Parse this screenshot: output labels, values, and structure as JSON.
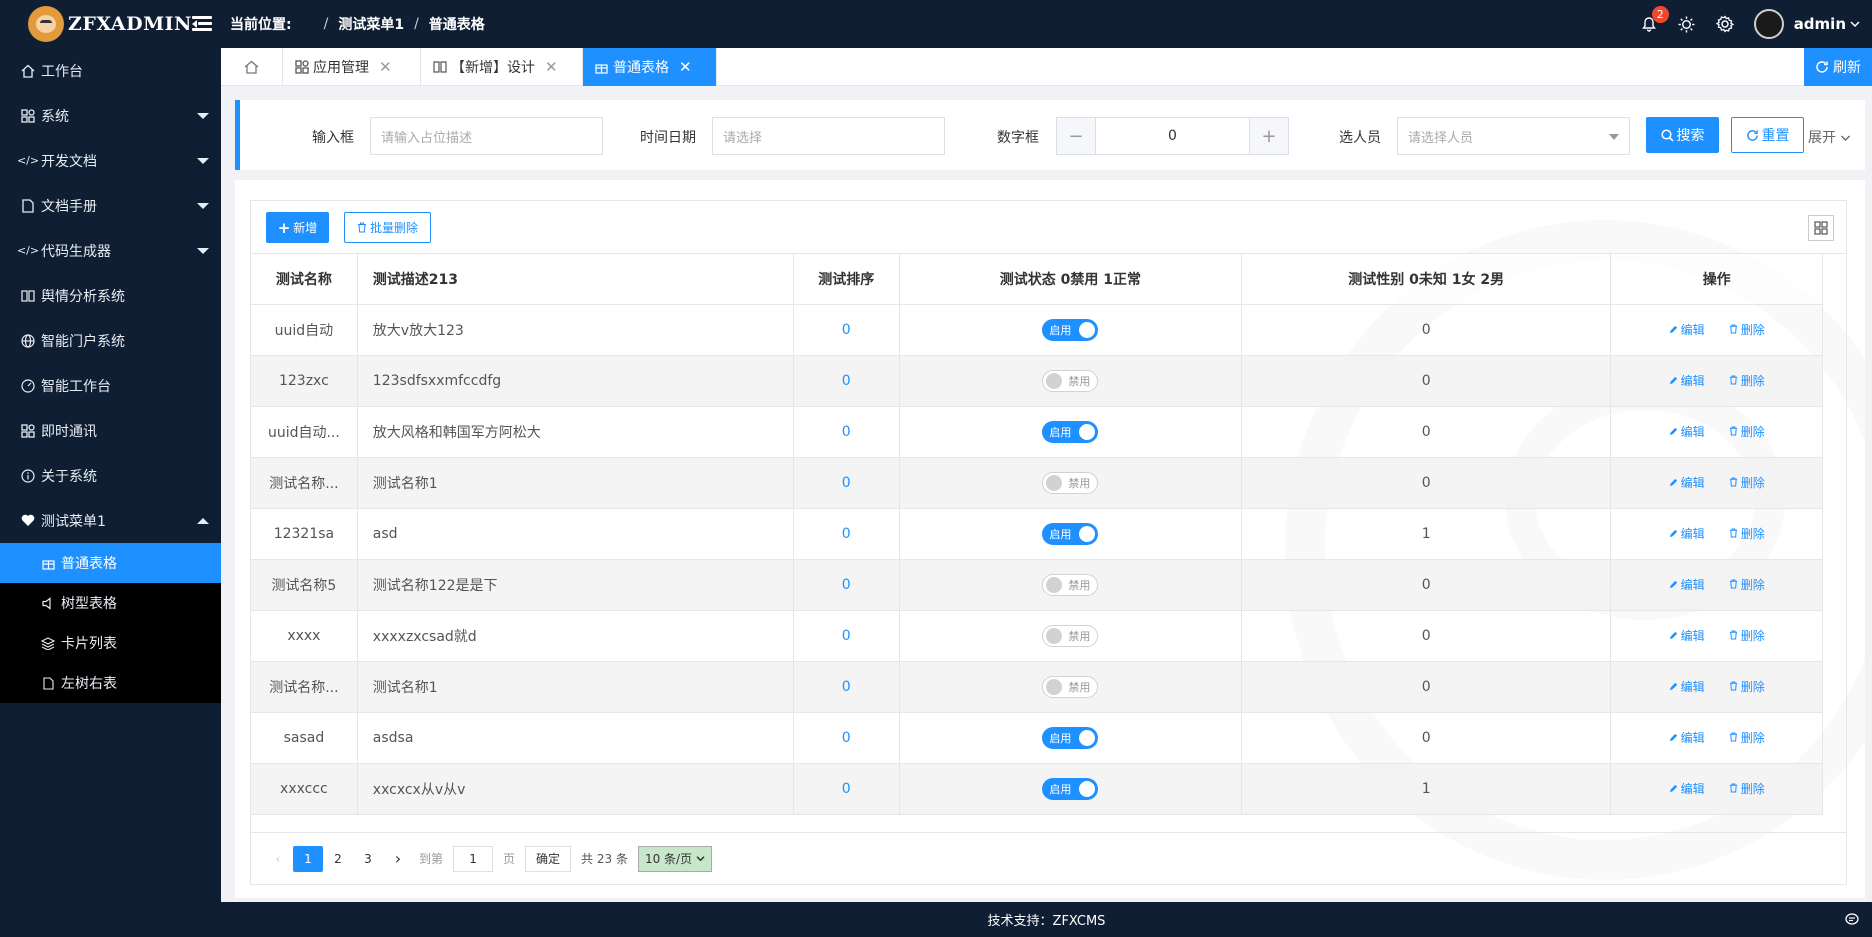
{
  "app": {
    "logo_text": "ZFXADMIN"
  },
  "header": {
    "location_label": "当前位置:",
    "crumbs": [
      "测试菜单1",
      "普通表格"
    ],
    "notification_count": "2",
    "user_name": "admin"
  },
  "sidebar": {
    "items": [
      {
        "label": "工作台",
        "icon": "home-icon"
      },
      {
        "label": "系统",
        "icon": "grid-icon"
      },
      {
        "label": "开发文档",
        "icon": "code-icon"
      },
      {
        "label": "文档手册",
        "icon": "file-icon"
      },
      {
        "label": "代码生成器",
        "icon": "code-icon"
      },
      {
        "label": "舆情分析系统",
        "icon": "read-icon"
      },
      {
        "label": "智能门户系统",
        "icon": "globe-icon"
      },
      {
        "label": "智能工作台",
        "icon": "dashboard-icon"
      },
      {
        "label": "即时通讯",
        "icon": "grid-icon"
      },
      {
        "label": "关于系统",
        "icon": "info-icon"
      },
      {
        "label": "测试菜单1",
        "icon": "heart-icon"
      }
    ],
    "sub_items": [
      {
        "label": "普通表格",
        "icon": "table-icon"
      },
      {
        "label": "树型表格",
        "icon": "speaker-icon"
      },
      {
        "label": "卡片列表",
        "icon": "layers-icon"
      },
      {
        "label": "左树右表",
        "icon": "doc-icon"
      }
    ]
  },
  "tabs": [
    {
      "label": "应用管理"
    },
    {
      "label": "【新增】设计"
    },
    {
      "label": "普通表格"
    }
  ],
  "refresh_label": "刷新",
  "search": {
    "input_label": "输入框",
    "input_placeholder": "请输入占位描述",
    "date_label": "时间日期",
    "date_placeholder": "请选择",
    "number_label": "数字框",
    "number_value": "0",
    "person_label": "选人员",
    "person_placeholder": "请选择人员",
    "search_btn": "搜索",
    "reset_btn": "重置",
    "expand_label": "展开"
  },
  "toolbar": {
    "add_label": "新增",
    "batch_delete_label": "批量删除"
  },
  "table": {
    "columns": [
      "测试名称",
      "测试描述213",
      "测试排序",
      "测试状态 0禁用 1正常",
      "测试性别 0未知 1女 2男",
      "操作"
    ],
    "on_label": "启用",
    "off_label": "禁用",
    "edit_label": "编辑",
    "delete_label": "删除",
    "rows": [
      {
        "name": "uuid自动",
        "desc": "放大v放大123",
        "sort": "0",
        "status": "on",
        "gender": "0"
      },
      {
        "name": "123zxc",
        "desc": "123sdfsxxmfccdfg",
        "sort": "0",
        "status": "off",
        "gender": "0"
      },
      {
        "name": "uuid自动...",
        "desc": "放大风格和韩国军方阿松大",
        "sort": "0",
        "status": "on",
        "gender": "0"
      },
      {
        "name": "测试名称...",
        "desc": "测试名称1",
        "sort": "0",
        "status": "off",
        "gender": "0"
      },
      {
        "name": "12321sa",
        "desc": "asd",
        "sort": "0",
        "status": "on",
        "gender": "1"
      },
      {
        "name": "测试名称5",
        "desc": "测试名称122是是下",
        "sort": "0",
        "status": "off",
        "gender": "0"
      },
      {
        "name": "xxxx",
        "desc": "xxxxzxcsad就d",
        "sort": "0",
        "status": "off",
        "gender": "0"
      },
      {
        "name": "测试名称...",
        "desc": "测试名称1",
        "sort": "0",
        "status": "off",
        "gender": "0"
      },
      {
        "name": "sasad",
        "desc": "asdsa",
        "sort": "0",
        "status": "on",
        "gender": "0"
      },
      {
        "name": "xxxccc",
        "desc": "xxcxcx从v从v",
        "sort": "0",
        "status": "on",
        "gender": "1"
      }
    ]
  },
  "pager": {
    "pages": [
      "1",
      "2",
      "3"
    ],
    "goto_label": "到第",
    "goto_value": "1",
    "page_unit": "页",
    "confirm_label": "确定",
    "total_label": "共 23 条",
    "size_label": "10 条/页"
  },
  "footer": {
    "text": "技术支持：ZFXCMS"
  },
  "colors": {
    "accent": "#1e90ff",
    "dark": "#0f1e33",
    "badge": "#f5462a"
  }
}
